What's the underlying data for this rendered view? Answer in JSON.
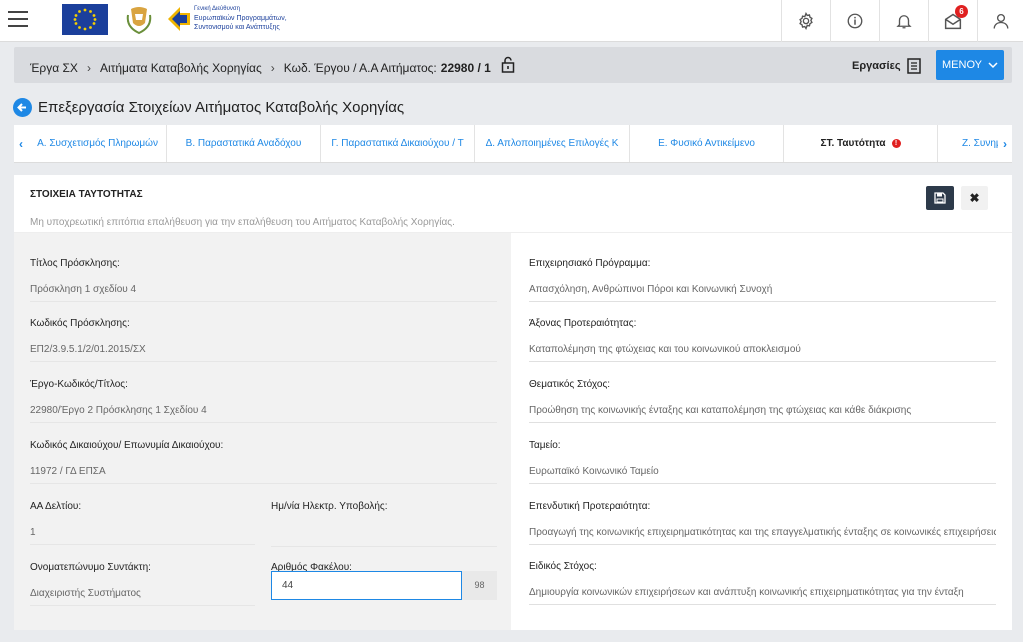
{
  "header": {
    "logo_line1": "Γενική Διεύθυνση",
    "logo_line2": "Ευρωπαϊκών Προγραμμάτων,",
    "logo_line3": "Συντονισμού και Ανάπτυξης",
    "notifications_count": "6"
  },
  "breadcrumb": {
    "items": [
      "Έργα ΣΧ",
      "Αιτήματα Καταβολής Χορηγίας",
      "Κωδ. Έργου / Α.Α Αιτήματος:"
    ],
    "code": "22980 / 1"
  },
  "toolbar": {
    "tasks_label": "Εργασίες",
    "menu_label": "ΜΕΝΟΥ"
  },
  "page": {
    "title": "Επεξεργασία Στοιχείων Αιτήματος Καταβολής Χορηγίας"
  },
  "tabs": [
    {
      "label": "Α. Συσχετισμός Πληρωμών"
    },
    {
      "label": "Β. Παραστατικά Αναδόχου"
    },
    {
      "label": "Γ. Παραστατικά Δικαιούχου / Τ"
    },
    {
      "label": "Δ. Απλοποιημένες Επιλογές Κ"
    },
    {
      "label": "Ε. Φυσικό Αντικείμενο"
    },
    {
      "label": "ΣΤ. Ταυτότητα"
    },
    {
      "label": "Ζ. Συνημμένα"
    }
  ],
  "panel": {
    "title": "ΣΤΟΙΧΕΙΑ ΤΑΥΤΟΤΗΤΑΣ",
    "subtitle": "Μη υποχρεωτική επιτόπια επαλήθευση για την επαλήθευση του Αιτήματος Καταβολής Χορηγίας.",
    "left": [
      {
        "label": "Τίτλος Πρόσκλησης:",
        "value": "Πρόσκληση 1 σχεδίου 4"
      },
      {
        "label": "Κωδικός Πρόσκλησης:",
        "value": "ΕΠ2/3.9.5.1/2/01.2015/ΣΧ"
      },
      {
        "label": "Έργο-Κωδικός/Τίτλος:",
        "value": "22980/Έργο 2 Πρόσκλησης 1 Σχεδίου 4"
      },
      {
        "label": "Κωδικός Δικαιούχου/ Επωνυμία Δικαιούχου:",
        "value": "11972 / ΓΔ ΕΠΣΑ"
      },
      {
        "label": "ΑΑ Δελτίου:",
        "value": "1"
      },
      {
        "label": "Ημ/νία Ηλεκτρ. Υποβολής:",
        "value": ""
      },
      {
        "label": "Ονοματεπώνυμο Συντάκτη:",
        "value": "Διαχειριστής Συστήματος"
      },
      {
        "label": "Αριθμός Φακέλου:",
        "value": "44",
        "counter": "98"
      }
    ],
    "right": [
      {
        "label": "Επιχειρησιακό Πρόγραμμα:",
        "value": "Απασχόληση, Ανθρώπινοι Πόροι και Κοινωνική Συνοχή"
      },
      {
        "label": "Άξονας Προτεραιότητας:",
        "value": "Καταπολέμηση της φτώχειας και του κοινωνικού αποκλεισμού"
      },
      {
        "label": "Θεματικός Στόχος:",
        "value": "Προώθηση της κοινωνικής ένταξης και καταπολέμηση της φτώχειας και κάθε διάκρισης"
      },
      {
        "label": "Ταμείο:",
        "value": "Ευρωπαϊκό Κοινωνικό Ταμείο"
      },
      {
        "label": "Επενδυτική Προτεραιότητα:",
        "value": "Προαγωγή της κοινωνικής επιχειρηματικότητας και της επαγγελματικής ένταξης σε κοινωνικές επιχειρήσεις"
      },
      {
        "label": "Ειδικός Στόχος:",
        "value": "Δημιουργία κοινωνικών επιχειρήσεων και ανάπτυξη κοινωνικής επιχειρηματικότητας για την ένταξη"
      }
    ]
  },
  "colors": {
    "accent": "#1e88e5",
    "error": "#e02020",
    "dark_button": "#2d3a4a"
  }
}
